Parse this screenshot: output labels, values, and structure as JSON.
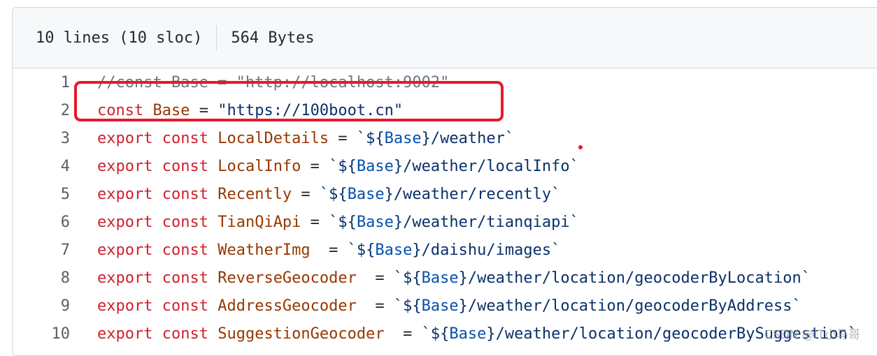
{
  "file_info": {
    "lines_label": "10 lines (10 sloc)",
    "size_label": "564 Bytes"
  },
  "code_lines": [
    {
      "num": "1",
      "tokens": [
        {
          "t": "comment",
          "v": "//const Base = \"http://localhost:9002\""
        }
      ]
    },
    {
      "num": "2",
      "tokens": [
        {
          "t": "kw",
          "v": "const"
        },
        {
          "t": "op",
          "v": " "
        },
        {
          "t": "var",
          "v": "Base"
        },
        {
          "t": "op",
          "v": " = "
        },
        {
          "t": "str",
          "v": "\"https://100boot.cn\""
        }
      ]
    },
    {
      "num": "3",
      "tokens": [
        {
          "t": "kw",
          "v": "export"
        },
        {
          "t": "op",
          "v": " "
        },
        {
          "t": "kw",
          "v": "const"
        },
        {
          "t": "op",
          "v": " "
        },
        {
          "t": "var",
          "v": "LocalDetails"
        },
        {
          "t": "op",
          "v": " = "
        },
        {
          "t": "str",
          "v": "`${"
        },
        {
          "t": "interp",
          "v": "Base"
        },
        {
          "t": "str",
          "v": "}/weather`"
        }
      ]
    },
    {
      "num": "4",
      "tokens": [
        {
          "t": "kw",
          "v": "export"
        },
        {
          "t": "op",
          "v": " "
        },
        {
          "t": "kw",
          "v": "const"
        },
        {
          "t": "op",
          "v": " "
        },
        {
          "t": "var",
          "v": "LocalInfo"
        },
        {
          "t": "op",
          "v": " = "
        },
        {
          "t": "str",
          "v": "`${"
        },
        {
          "t": "interp",
          "v": "Base"
        },
        {
          "t": "str",
          "v": "}/weather/localInfo`"
        }
      ]
    },
    {
      "num": "5",
      "tokens": [
        {
          "t": "kw",
          "v": "export"
        },
        {
          "t": "op",
          "v": " "
        },
        {
          "t": "kw",
          "v": "const"
        },
        {
          "t": "op",
          "v": " "
        },
        {
          "t": "var",
          "v": "Recently"
        },
        {
          "t": "op",
          "v": " = "
        },
        {
          "t": "str",
          "v": "`${"
        },
        {
          "t": "interp",
          "v": "Base"
        },
        {
          "t": "str",
          "v": "}/weather/recently`"
        }
      ]
    },
    {
      "num": "6",
      "tokens": [
        {
          "t": "kw",
          "v": "export"
        },
        {
          "t": "op",
          "v": " "
        },
        {
          "t": "kw",
          "v": "const"
        },
        {
          "t": "op",
          "v": " "
        },
        {
          "t": "var",
          "v": "TianQiApi"
        },
        {
          "t": "op",
          "v": " = "
        },
        {
          "t": "str",
          "v": "`${"
        },
        {
          "t": "interp",
          "v": "Base"
        },
        {
          "t": "str",
          "v": "}/weather/tianqiapi`"
        }
      ]
    },
    {
      "num": "7",
      "tokens": [
        {
          "t": "kw",
          "v": "export"
        },
        {
          "t": "op",
          "v": " "
        },
        {
          "t": "kw",
          "v": "const"
        },
        {
          "t": "op",
          "v": " "
        },
        {
          "t": "var",
          "v": "WeatherImg"
        },
        {
          "t": "op",
          "v": "  = "
        },
        {
          "t": "str",
          "v": "`${"
        },
        {
          "t": "interp",
          "v": "Base"
        },
        {
          "t": "str",
          "v": "}/daishu/images`"
        }
      ]
    },
    {
      "num": "8",
      "tokens": [
        {
          "t": "kw",
          "v": "export"
        },
        {
          "t": "op",
          "v": " "
        },
        {
          "t": "kw",
          "v": "const"
        },
        {
          "t": "op",
          "v": " "
        },
        {
          "t": "var",
          "v": "ReverseGeocoder"
        },
        {
          "t": "op",
          "v": "  = "
        },
        {
          "t": "str",
          "v": "`${"
        },
        {
          "t": "interp",
          "v": "Base"
        },
        {
          "t": "str",
          "v": "}/weather/location/geocoderByLocation`"
        }
      ]
    },
    {
      "num": "9",
      "tokens": [
        {
          "t": "kw",
          "v": "export"
        },
        {
          "t": "op",
          "v": " "
        },
        {
          "t": "kw",
          "v": "const"
        },
        {
          "t": "op",
          "v": " "
        },
        {
          "t": "var",
          "v": "AddressGeocoder"
        },
        {
          "t": "op",
          "v": "  = "
        },
        {
          "t": "str",
          "v": "`${"
        },
        {
          "t": "interp",
          "v": "Base"
        },
        {
          "t": "str",
          "v": "}/weather/location/geocoderByAddress`"
        }
      ]
    },
    {
      "num": "10",
      "tokens": [
        {
          "t": "kw",
          "v": "export"
        },
        {
          "t": "op",
          "v": " "
        },
        {
          "t": "kw",
          "v": "const"
        },
        {
          "t": "op",
          "v": " "
        },
        {
          "t": "var",
          "v": "SuggestionGeocoder"
        },
        {
          "t": "op",
          "v": "  = "
        },
        {
          "t": "str",
          "v": "`${"
        },
        {
          "t": "interp",
          "v": "Base"
        },
        {
          "t": "str",
          "v": "}/weather/location/geocoderBySuggestion`"
        }
      ]
    }
  ],
  "annotation": {
    "highlighted_line": "2",
    "color": "#e8192b"
  },
  "watermark": "CSDN @IT小马哥"
}
